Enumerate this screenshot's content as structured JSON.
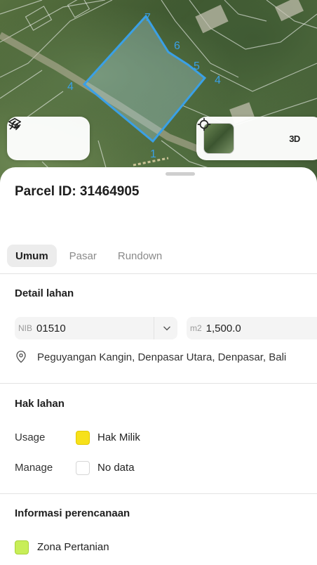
{
  "map": {
    "vertex_labels": [
      "7",
      "6",
      "5",
      "4",
      "4",
      "1"
    ],
    "layers_icon": "layers-icon",
    "draw_icon": "draw-pen-icon",
    "locate_icon": "crosshair-icon",
    "mode_3d_label": "3D",
    "parcel_color": "#3aa0e6"
  },
  "sheet": {
    "parcel_label": "Parcel ID: 31464905",
    "tabs": [
      {
        "label": "Umum",
        "active": true
      },
      {
        "label": "Pasar",
        "active": false
      },
      {
        "label": "Rundown",
        "active": false
      }
    ]
  },
  "detail": {
    "title": "Detail lahan",
    "nib_prefix": "NIB",
    "nib_value": "01510",
    "area_prefix": "m2",
    "area_value": "1,500.0",
    "location": "Peguyangan Kangin, Denpasar Utara, Denpasar, Bali"
  },
  "hak": {
    "title": "Hak lahan",
    "usage_label": "Usage",
    "usage_value": "Hak Milik",
    "usage_color": "#f7e11a",
    "manage_label": "Manage",
    "manage_value": "No data"
  },
  "planning": {
    "title": "Informasi perencanaan",
    "zone_value": "Zona Pertanian",
    "zone_color": "#c8ee58"
  }
}
